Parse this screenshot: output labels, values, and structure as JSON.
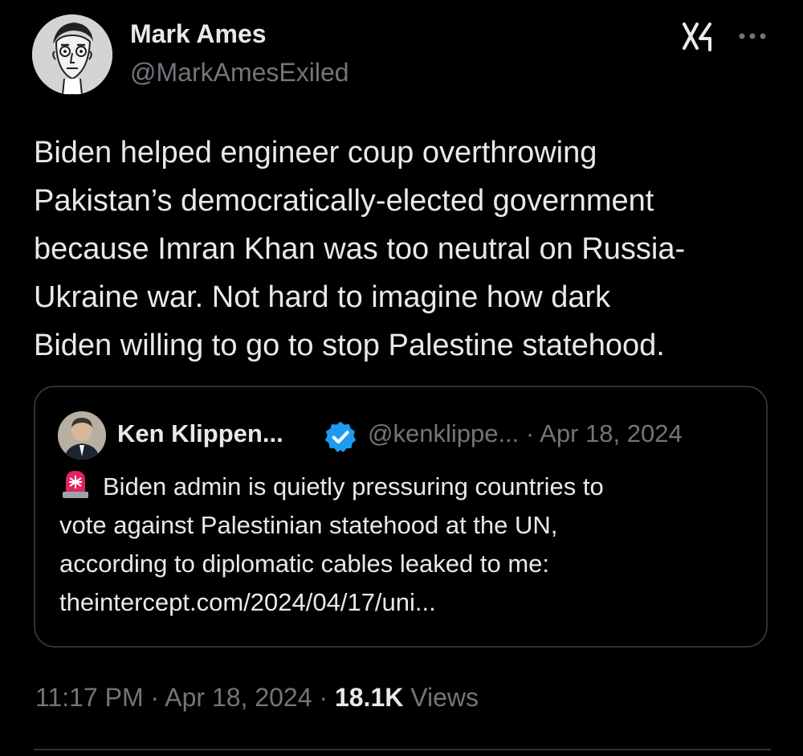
{
  "author": {
    "name": "Mark Ames",
    "handle": "@MarkAmesExiled"
  },
  "header_icons": [
    "grok-icon",
    "more-options-icon"
  ],
  "tweet": {
    "lines": [
      "Biden helped engineer coup overthrowing",
      "Pakistan’s democratically-elected government",
      "because Imran Khan was too neutral on Russia-",
      "Ukraine war. Not hard to imagine how dark",
      "Biden willing to go to stop Palestine statehood."
    ]
  },
  "quote": {
    "name": "Ken Klippen...",
    "verified": true,
    "handle": "@kenklippe...",
    "separator": "·",
    "date": "Apr 18, 2024",
    "emoji": "rotating-light-icon",
    "lines": [
      "Biden admin is quietly pressuring countries to",
      "vote against Palestinian statehood at the UN,",
      "according to diplomatic cables leaked to me:",
      "theintercept.com/2024/04/17/uni..."
    ]
  },
  "meta": {
    "time": "11:17 PM",
    "dot1": "·",
    "date": "Apr 18, 2024",
    "dot2": "·",
    "views_count": "18.1K",
    "views_label": "Views"
  },
  "colors": {
    "background": "#000000",
    "text": "#e7e9ea",
    "secondary": "#71767b",
    "border": "#2f3336",
    "verified": "#1d9bf0"
  }
}
